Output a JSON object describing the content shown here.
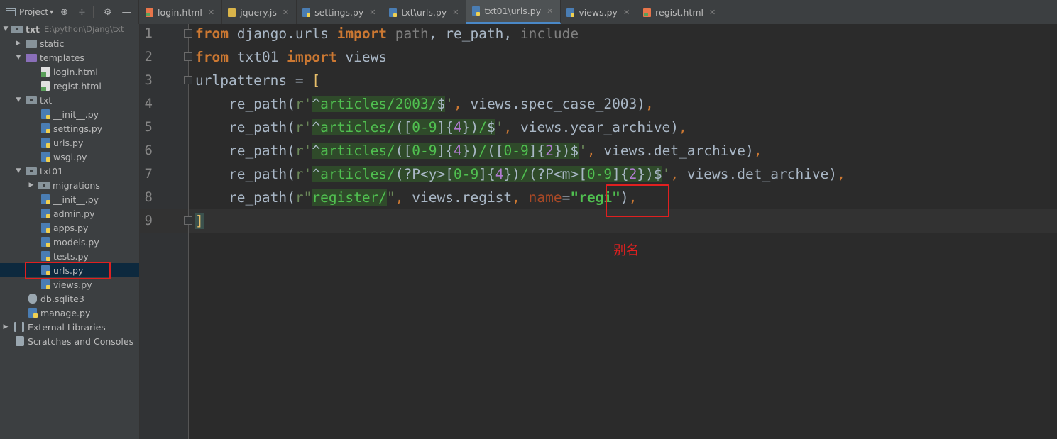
{
  "project_panel": {
    "title": "Project",
    "dropdown_arrow": "▾",
    "tools": [
      "⊕",
      "≑",
      "⚙",
      "—"
    ]
  },
  "tabs": [
    {
      "label": "login.html",
      "icon": "html-file-icon",
      "active": false
    },
    {
      "label": "jquery.js",
      "icon": "js-file-icon",
      "active": false
    },
    {
      "label": "settings.py",
      "icon": "python-file-icon",
      "active": false
    },
    {
      "label": "txt\\urls.py",
      "icon": "python-file-icon",
      "active": false
    },
    {
      "label": "txt01\\urls.py",
      "icon": "python-file-icon",
      "active": true
    },
    {
      "label": "views.py",
      "icon": "python-file-icon",
      "active": false
    },
    {
      "label": "regist.html",
      "icon": "html-file-icon",
      "active": false
    }
  ],
  "tree": {
    "root": {
      "label": "txt",
      "path": "E:\\python\\Djang\\txt"
    },
    "items": [
      {
        "label": "static"
      },
      {
        "label": "templates"
      },
      {
        "label": "login.html"
      },
      {
        "label": "regist.html"
      },
      {
        "label": "txt"
      },
      {
        "label": "__init__.py"
      },
      {
        "label": "settings.py"
      },
      {
        "label": "urls.py"
      },
      {
        "label": "wsgi.py"
      },
      {
        "label": "txt01"
      },
      {
        "label": "migrations"
      },
      {
        "label": "__init__.py"
      },
      {
        "label": "admin.py"
      },
      {
        "label": "apps.py"
      },
      {
        "label": "models.py"
      },
      {
        "label": "tests.py"
      },
      {
        "label": "urls.py"
      },
      {
        "label": "views.py"
      },
      {
        "label": "db.sqlite3"
      },
      {
        "label": "manage.py"
      },
      {
        "label": "External Libraries"
      },
      {
        "label": "Scratches and Consoles"
      }
    ]
  },
  "editor": {
    "line_numbers": [
      "1",
      "2",
      "3",
      "4",
      "5",
      "6",
      "7",
      "8",
      "9"
    ],
    "current_line": 9
  },
  "annotation": {
    "note": "别名"
  },
  "colors": {
    "keyword": "#cc7832",
    "string": "#6a8759",
    "param": "#aa4926",
    "highlight_box": "#e02020"
  }
}
